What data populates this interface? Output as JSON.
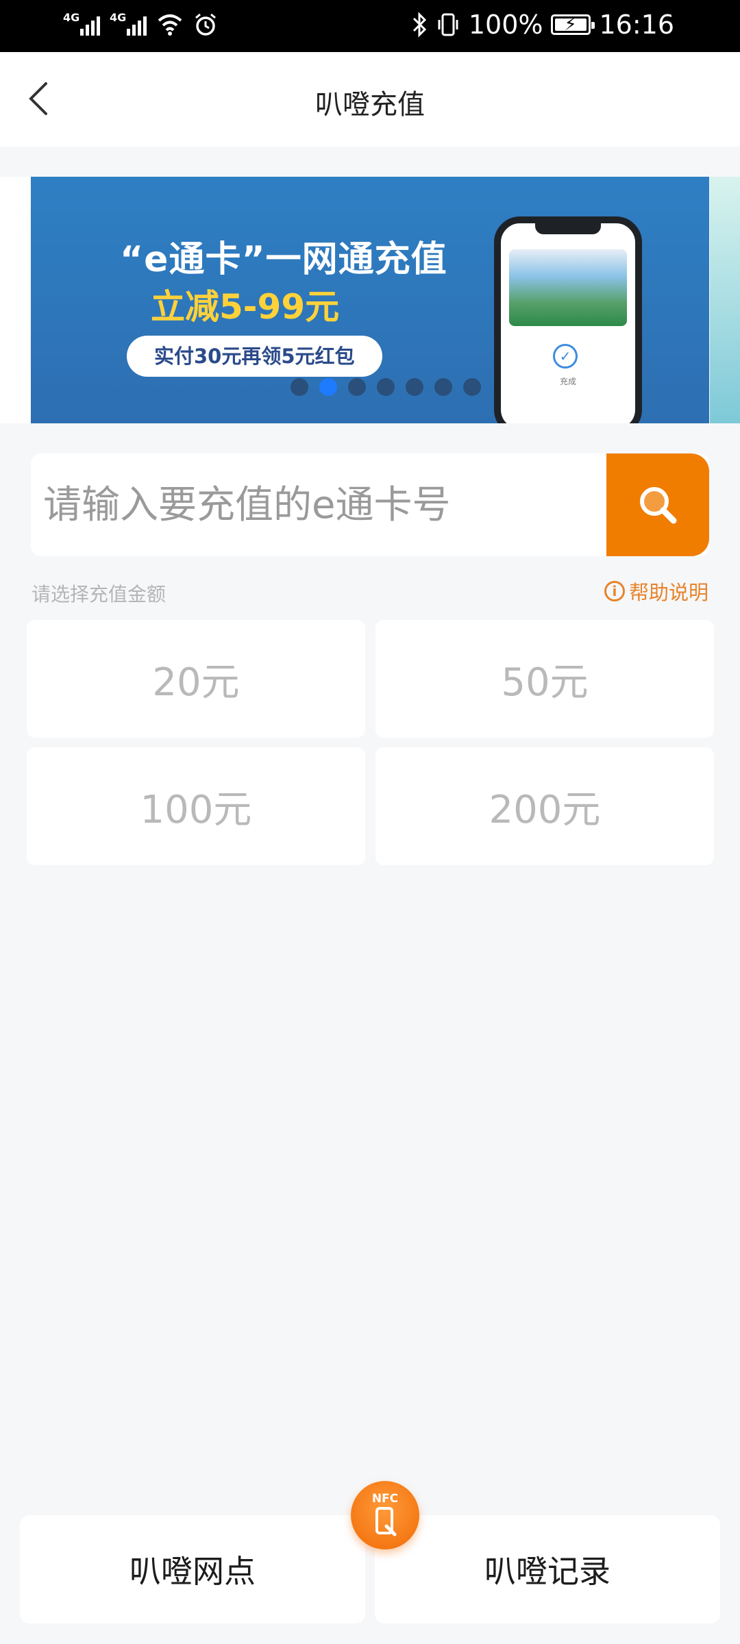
{
  "status_bar": {
    "network_1": "4G",
    "network_2": "4G",
    "battery": "100%",
    "time": "16:16"
  },
  "header": {
    "title": "叭噔充值"
  },
  "banner": {
    "headline": "“e通卡”一网通充值",
    "discount": "立减5-99元",
    "promo": "实付30元再领5元红包",
    "phone_status": "充成",
    "slide_count": 7,
    "active_slide": 2
  },
  "search": {
    "placeholder": "请输入要充值的e通卡号"
  },
  "amount_section": {
    "label": "请选择充值金额",
    "help": "帮助说明",
    "options": [
      "20元",
      "50元",
      "100元",
      "200元"
    ]
  },
  "bottom": {
    "left": "叭噔网点",
    "right": "叭噔记录",
    "nfc_label": "NFC"
  },
  "colors": {
    "accent": "#f07d00",
    "banner_bg": "#2f7fc4",
    "help": "#e8832a"
  }
}
